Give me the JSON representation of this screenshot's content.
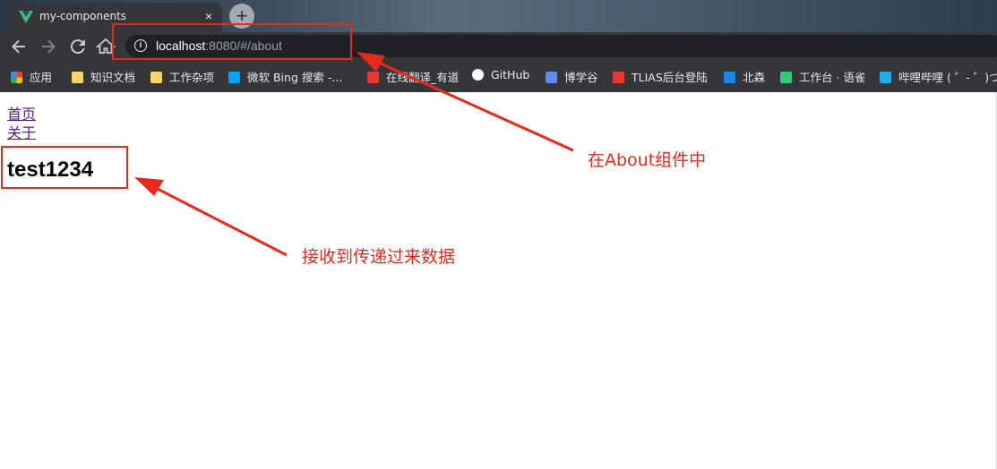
{
  "browser": {
    "tab_title": "my-components",
    "tab_close": "×",
    "new_tab": "+",
    "url_host": "localhost",
    "url_rest": ":8080/#/about",
    "nav_icons": [
      "back-icon",
      "forward-icon",
      "reload-icon",
      "home-icon"
    ],
    "bookmarks": [
      {
        "label": "应用",
        "icon": "apps-grid-icon",
        "color": "#e94235"
      },
      {
        "label": "知识文档",
        "icon": "folder-icon",
        "color": "#f6d66b"
      },
      {
        "label": "工作杂项",
        "icon": "folder-icon",
        "color": "#f6d66b"
      },
      {
        "label": "微软 Bing 搜索 -...",
        "icon": "bing-icon",
        "color": "#00a4ef"
      },
      {
        "label": "在线翻译_有道",
        "icon": "youdao-icon",
        "color": "#e53935"
      },
      {
        "label": "GitHub",
        "icon": "github-icon",
        "color": "#ffffff"
      },
      {
        "label": "博学谷",
        "icon": "boxuegu-icon",
        "color": "#5b8def"
      },
      {
        "label": "TLIAS后台登陆",
        "icon": "tlias-icon",
        "color": "#e53935"
      },
      {
        "label": "北森",
        "icon": "beisen-icon",
        "color": "#1e88e5"
      },
      {
        "label": "工作台 · 语雀",
        "icon": "yuque-icon",
        "color": "#31cc79"
      },
      {
        "label": "哔哩哔哩 ( ゜- ゜)つ...",
        "icon": "bilibili-icon",
        "color": "#23ade5"
      }
    ]
  },
  "page": {
    "links": [
      "首页",
      "关于"
    ],
    "heading": "test1234"
  },
  "annotations": {
    "about_note": "在About组件中",
    "data_note": "接收到传递过来数据",
    "color": "#e8291c"
  }
}
